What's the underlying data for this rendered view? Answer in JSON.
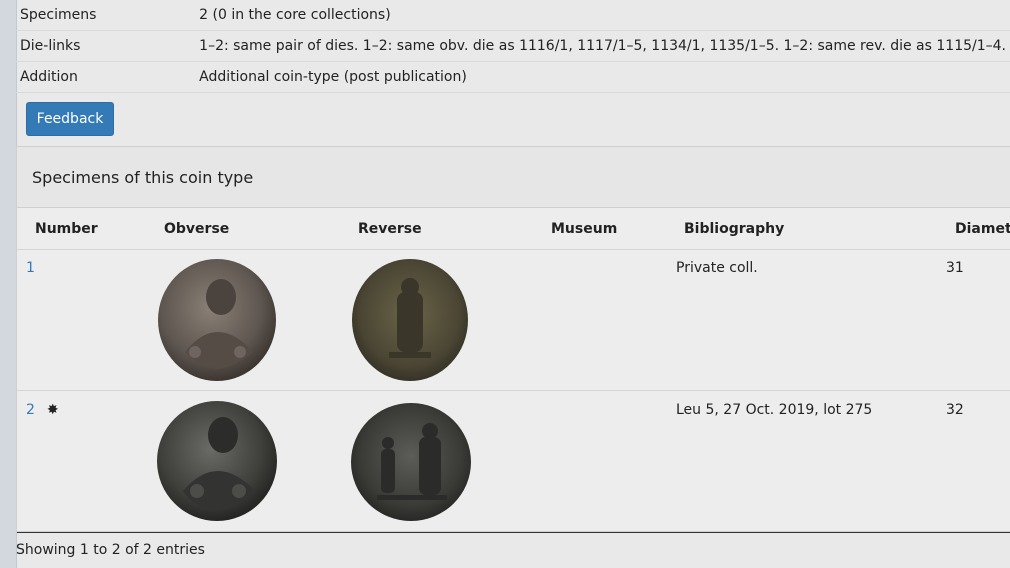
{
  "info": [
    {
      "key": "Specimens",
      "value": "2 (0 in the core collections)"
    },
    {
      "key": "Die-links",
      "value": "1–2: same pair of dies. 1–2: same obv. die as 1116/1, 1117/1–5, 1134/1, 1135/1–5. 1–2: same rev. die as 1115/1–4."
    },
    {
      "key": "Addition",
      "value": "Additional coin-type (post publication)"
    }
  ],
  "feedback_label": "Feedback",
  "panel_title": "Specimens of this coin type",
  "columns": {
    "number": "Number",
    "obverse": "Obverse",
    "reverse": "Reverse",
    "museum": "Museum",
    "bibliography": "Bibliography",
    "diameter": "Diamete"
  },
  "rows": [
    {
      "number": "1",
      "star": "",
      "museum": "",
      "bibliography": "Private coll.",
      "diameter": "31"
    },
    {
      "number": "2",
      "star": "✸",
      "museum": "",
      "bibliography": "Leu 5, 27 Oct. 2019, lot 275",
      "diameter": "32"
    }
  ],
  "footer": "Showing 1 to 2 of 2 entries",
  "colors": {
    "link": "#337ab7",
    "button": "#337ab7"
  }
}
